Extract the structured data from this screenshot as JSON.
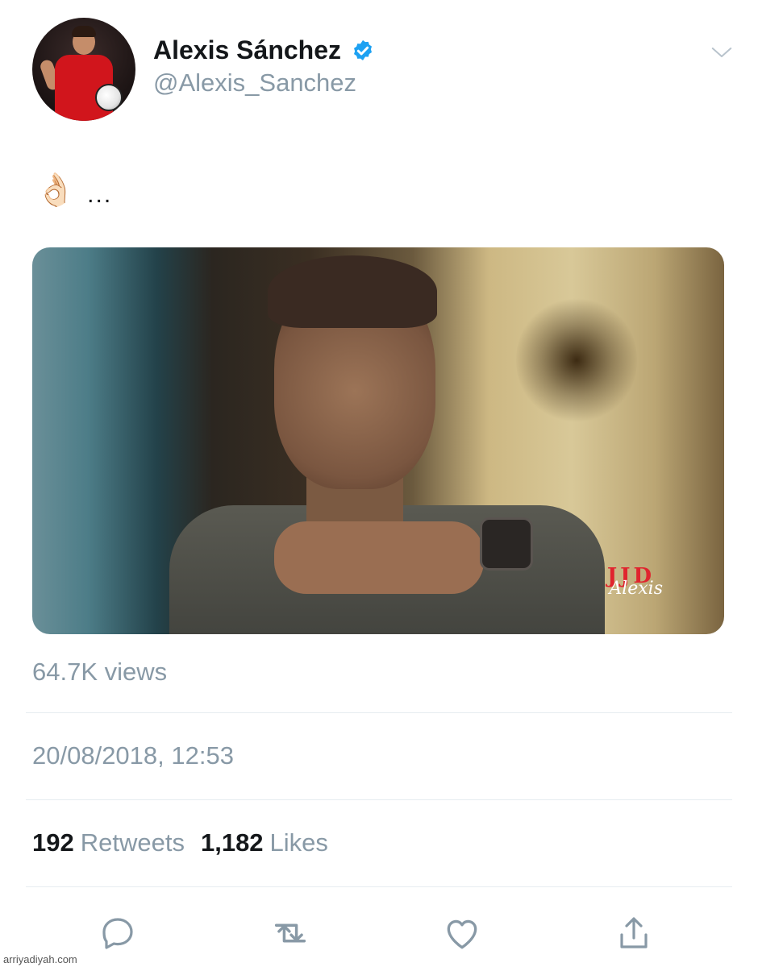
{
  "author": {
    "display_name": "Alexis Sánchez",
    "handle": "@Alexis_Sanchez",
    "verified": true
  },
  "tweet": {
    "emoji": "👌🏻",
    "text": "..."
  },
  "media": {
    "watermark_main": "JJD",
    "watermark_signature": "Alexis"
  },
  "views": "64.7K views",
  "timestamp": "20/08/2018, 12:53",
  "stats": {
    "retweets_count": "192",
    "retweets_label": "Retweets",
    "likes_count": "1,182",
    "likes_label": "Likes"
  },
  "actions": {
    "icons": [
      "reply-icon",
      "retweet-icon",
      "like-icon",
      "share-icon"
    ]
  },
  "footer": {
    "site_credit": "arriyadiyah.com"
  },
  "colors": {
    "text_primary": "#14171a",
    "text_secondary": "#8899a6",
    "verified_blue": "#1da1f2",
    "divider": "#e6ecf0",
    "watermark_red": "#e0242e"
  }
}
